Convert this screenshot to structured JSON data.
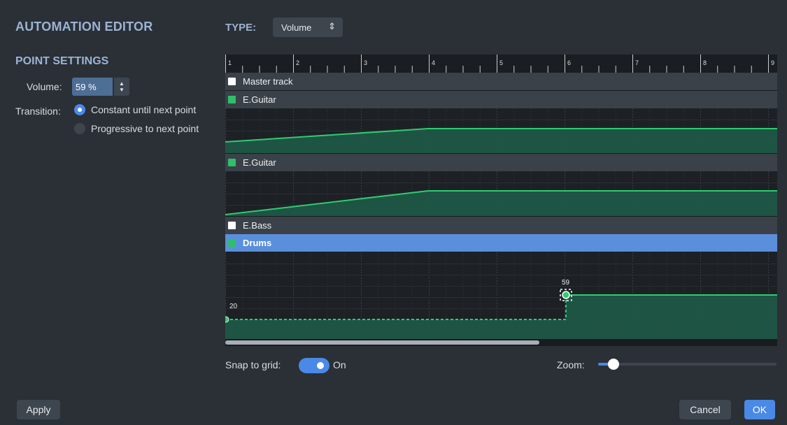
{
  "header": {
    "title": "AUTOMATION EDITOR",
    "type_label": "TYPE:",
    "type_value": "Volume"
  },
  "point_settings": {
    "title": "POINT SETTINGS",
    "volume_label": "Volume:",
    "volume_value": "59 %",
    "transition_label": "Transition:",
    "options": [
      {
        "label": "Constant until next point",
        "selected": true
      },
      {
        "label": "Progressive to next point",
        "selected": false
      }
    ]
  },
  "ruler": {
    "bars": [
      "1",
      "2",
      "3",
      "4",
      "5",
      "6",
      "7",
      "8",
      "9"
    ]
  },
  "tracks": [
    {
      "name": "Master track",
      "swatch": "white",
      "selected": false
    },
    {
      "name": "E.Guitar",
      "swatch": "green",
      "selected": false
    },
    {
      "name": "E.Guitar",
      "swatch": "green",
      "selected": false
    },
    {
      "name": "E.Bass",
      "swatch": "white",
      "selected": false
    },
    {
      "name": "Drums",
      "swatch": "green",
      "selected": true
    }
  ],
  "drums_points": [
    {
      "label": "20"
    },
    {
      "label": "59"
    }
  ],
  "footer": {
    "snap_label": "Snap to grid:",
    "snap_state": "On",
    "zoom_label": "Zoom:",
    "apply": "Apply",
    "cancel": "Cancel",
    "ok": "OK"
  },
  "colors": {
    "accent": "#4a89e6",
    "automation_line": "#2ecc71",
    "automation_fill": "#1f5a48",
    "selected_track": "#5a8fdb",
    "heading": "#9bb3d4"
  }
}
